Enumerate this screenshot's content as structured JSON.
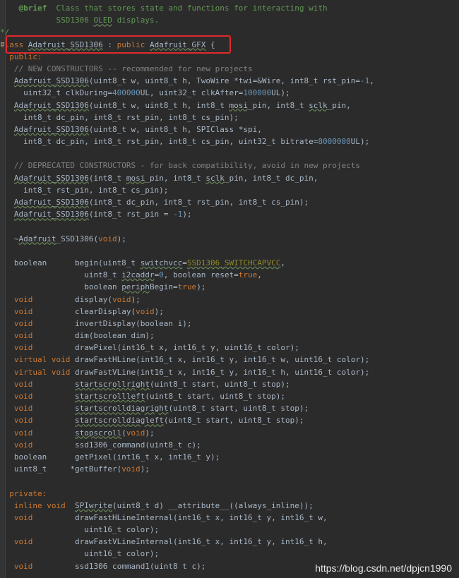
{
  "editor": {
    "lines": [
      [
        {
          "t": "    ",
          "c": "plain"
        },
        {
          "t": "@brief",
          "c": "tag"
        },
        {
          "t": "  Class that stores state and functions for interacting with",
          "c": "doc"
        }
      ],
      [
        {
          "t": "            SSD1306 ",
          "c": "doc"
        },
        {
          "t": "OLED",
          "c": "doc-ul"
        },
        {
          "t": " displays.",
          "c": "doc"
        }
      ],
      [
        {
          "t": "*/",
          "c": "doc"
        }
      ],
      [
        {
          "t": "class ",
          "c": "kw"
        },
        {
          "t": "Adafruit_SSD1306",
          "c": "ty-ul"
        },
        {
          "t": " : ",
          "c": "plain"
        },
        {
          "t": "public ",
          "c": "kw"
        },
        {
          "t": "Adafruit_GFX",
          "c": "ty-ul"
        },
        {
          "t": " {",
          "c": "plain"
        }
      ],
      [
        {
          "t": "  ",
          "c": "plain"
        },
        {
          "t": "public:",
          "c": "kw"
        }
      ],
      [
        {
          "t": "   ",
          "c": "plain"
        },
        {
          "t": "// NEW CONSTRUCTORS -- recommended for new projects",
          "c": "cmt"
        }
      ],
      [
        {
          "t": "   ",
          "c": "plain"
        },
        {
          "t": "Adafruit_SSD1306",
          "c": "fn-ul"
        },
        {
          "t": "(uint8_t w, uint8_t h, TwoWire *twi=&Wire, int8_t rst_pin=",
          "c": "plain"
        },
        {
          "t": "-1",
          "c": "num"
        },
        {
          "t": ",",
          "c": "plain"
        }
      ],
      [
        {
          "t": "     uint32_t clkDuring=",
          "c": "plain"
        },
        {
          "t": "400000",
          "c": "num"
        },
        {
          "t": "UL, uint32_t clkAfter=",
          "c": "plain"
        },
        {
          "t": "100000",
          "c": "num"
        },
        {
          "t": "UL);",
          "c": "plain"
        }
      ],
      [
        {
          "t": "   ",
          "c": "plain"
        },
        {
          "t": "Adafruit_SSD1306",
          "c": "fn-ul"
        },
        {
          "t": "(uint8_t w, uint8_t h, int8_t ",
          "c": "plain"
        },
        {
          "t": "mosi",
          "c": "plain-ul"
        },
        {
          "t": "_pin, int8_t ",
          "c": "plain"
        },
        {
          "t": "sclk",
          "c": "plain-ul"
        },
        {
          "t": "_pin,",
          "c": "plain"
        }
      ],
      [
        {
          "t": "     int8_t dc_pin, int8_t rst_pin, int8_t cs_pin);",
          "c": "plain"
        }
      ],
      [
        {
          "t": "   ",
          "c": "plain"
        },
        {
          "t": "Adafruit_SSD1306",
          "c": "fn-ul"
        },
        {
          "t": "(uint8_t w, uint8_t h, SPIClass *spi,",
          "c": "plain"
        }
      ],
      [
        {
          "t": "     int8_t dc_pin, int8_t rst_pin, int8_t cs_pin, uint32_t bitrate=",
          "c": "plain"
        },
        {
          "t": "8000000",
          "c": "num"
        },
        {
          "t": "UL);",
          "c": "plain"
        }
      ],
      [
        {
          "t": "",
          "c": "plain"
        }
      ],
      [
        {
          "t": "   ",
          "c": "plain"
        },
        {
          "t": "// DEPRECATED CONSTRUCTORS - for back compatibility, avoid in new projects",
          "c": "cmt"
        }
      ],
      [
        {
          "t": "   ",
          "c": "plain"
        },
        {
          "t": "Adafruit_SSD1306",
          "c": "fn-ul"
        },
        {
          "t": "(int8_t ",
          "c": "plain"
        },
        {
          "t": "mosi",
          "c": "plain-ul"
        },
        {
          "t": "_pin, int8_t ",
          "c": "plain"
        },
        {
          "t": "sclk",
          "c": "plain-ul"
        },
        {
          "t": "_pin, int8_t dc_pin,",
          "c": "plain"
        }
      ],
      [
        {
          "t": "     int8_t rst_pin, int8_t cs_pin);",
          "c": "plain"
        }
      ],
      [
        {
          "t": "   ",
          "c": "plain"
        },
        {
          "t": "Adafruit_SSD1306",
          "c": "fn-ul"
        },
        {
          "t": "(int8_t dc_pin, int8_t rst_pin, int8_t cs_pin);",
          "c": "plain"
        }
      ],
      [
        {
          "t": "   ",
          "c": "plain"
        },
        {
          "t": "Adafruit_SSD1306",
          "c": "fn-ul"
        },
        {
          "t": "(int8_t rst_pin = ",
          "c": "plain"
        },
        {
          "t": "-1",
          "c": "num"
        },
        {
          "t": ");",
          "c": "plain"
        }
      ],
      [
        {
          "t": "",
          "c": "plain"
        }
      ],
      [
        {
          "t": "   ~",
          "c": "plain"
        },
        {
          "t": "Adafruit",
          "c": "fn-ul"
        },
        {
          "t": "_SSD1306(",
          "c": "plain"
        },
        {
          "t": "void",
          "c": "kw"
        },
        {
          "t": ");",
          "c": "plain"
        }
      ],
      [
        {
          "t": "",
          "c": "plain"
        }
      ],
      [
        {
          "t": "   boolean      begin(uint8_t ",
          "c": "plain"
        },
        {
          "t": "switchvcc",
          "c": "plain-ul"
        },
        {
          "t": "=",
          "c": "plain"
        },
        {
          "t": "SSD1306_SWITCHCAPVCC",
          "c": "mac-ul"
        },
        {
          "t": ",",
          "c": "plain"
        }
      ],
      [
        {
          "t": "                  uint8_t ",
          "c": "plain"
        },
        {
          "t": "i2caddr",
          "c": "plain-ul"
        },
        {
          "t": "=",
          "c": "plain"
        },
        {
          "t": "0",
          "c": "num"
        },
        {
          "t": ", boolean reset=",
          "c": "plain"
        },
        {
          "t": "true",
          "c": "kw"
        },
        {
          "t": ",",
          "c": "plain"
        }
      ],
      [
        {
          "t": "                  boolean ",
          "c": "plain"
        },
        {
          "t": "periph",
          "c": "plain-ul"
        },
        {
          "t": "Begin=",
          "c": "plain"
        },
        {
          "t": "true",
          "c": "kw"
        },
        {
          "t": ");",
          "c": "plain"
        }
      ],
      [
        {
          "t": "   ",
          "c": "plain"
        },
        {
          "t": "void",
          "c": "kw"
        },
        {
          "t": "         display(",
          "c": "plain"
        },
        {
          "t": "void",
          "c": "kw"
        },
        {
          "t": ");",
          "c": "plain"
        }
      ],
      [
        {
          "t": "   ",
          "c": "plain"
        },
        {
          "t": "void",
          "c": "kw"
        },
        {
          "t": "         clearDisplay(",
          "c": "plain"
        },
        {
          "t": "void",
          "c": "kw"
        },
        {
          "t": ");",
          "c": "plain"
        }
      ],
      [
        {
          "t": "   ",
          "c": "plain"
        },
        {
          "t": "void",
          "c": "kw"
        },
        {
          "t": "         invertDisplay(boolean i);",
          "c": "plain"
        }
      ],
      [
        {
          "t": "   ",
          "c": "plain"
        },
        {
          "t": "void",
          "c": "kw"
        },
        {
          "t": "         dim(boolean dim);",
          "c": "plain"
        }
      ],
      [
        {
          "t": "   ",
          "c": "plain"
        },
        {
          "t": "void",
          "c": "kw"
        },
        {
          "t": "         drawPixel(int16_t x, int16_t y, uint16_t color);",
          "c": "plain"
        }
      ],
      [
        {
          "t": "   ",
          "c": "plain"
        },
        {
          "t": "virtual void",
          "c": "kw"
        },
        {
          "t": " drawFastHLine(int16_t x, int16_t y, int16_t w, uint16_t color);",
          "c": "plain"
        }
      ],
      [
        {
          "t": "   ",
          "c": "plain"
        },
        {
          "t": "virtual void",
          "c": "kw"
        },
        {
          "t": " drawFastVLine(int16_t x, int16_t y, int16_t h, uint16_t color);",
          "c": "plain"
        }
      ],
      [
        {
          "t": "   ",
          "c": "plain"
        },
        {
          "t": "void",
          "c": "kw"
        },
        {
          "t": "         ",
          "c": "plain"
        },
        {
          "t": "startscrollright",
          "c": "plain-ul"
        },
        {
          "t": "(uint8_t start, uint8_t stop);",
          "c": "plain"
        }
      ],
      [
        {
          "t": "   ",
          "c": "plain"
        },
        {
          "t": "void",
          "c": "kw"
        },
        {
          "t": "         ",
          "c": "plain"
        },
        {
          "t": "startscrollleft",
          "c": "plain-ul"
        },
        {
          "t": "(uint8_t start, uint8_t stop);",
          "c": "plain"
        }
      ],
      [
        {
          "t": "   ",
          "c": "plain"
        },
        {
          "t": "void",
          "c": "kw"
        },
        {
          "t": "         ",
          "c": "plain"
        },
        {
          "t": "startscrolldiagright",
          "c": "plain-ul"
        },
        {
          "t": "(uint8_t start, uint8_t stop);",
          "c": "plain"
        }
      ],
      [
        {
          "t": "   ",
          "c": "plain"
        },
        {
          "t": "void",
          "c": "kw"
        },
        {
          "t": "         ",
          "c": "plain"
        },
        {
          "t": "startscrolldiagleft",
          "c": "plain-ul"
        },
        {
          "t": "(uint8_t start, uint8_t stop);",
          "c": "plain"
        }
      ],
      [
        {
          "t": "   ",
          "c": "plain"
        },
        {
          "t": "void",
          "c": "kw"
        },
        {
          "t": "         ",
          "c": "plain"
        },
        {
          "t": "stopscroll",
          "c": "plain-ul"
        },
        {
          "t": "(",
          "c": "plain"
        },
        {
          "t": "void",
          "c": "kw"
        },
        {
          "t": ");",
          "c": "plain"
        }
      ],
      [
        {
          "t": "   ",
          "c": "plain"
        },
        {
          "t": "void",
          "c": "kw"
        },
        {
          "t": "         ssd1306_command(uint8_t c);",
          "c": "plain"
        }
      ],
      [
        {
          "t": "   boolean      getPixel(int16_t x, int16_t y);",
          "c": "plain"
        }
      ],
      [
        {
          "t": "   uint8_t     *getBuffer(",
          "c": "plain"
        },
        {
          "t": "void",
          "c": "kw"
        },
        {
          "t": ");",
          "c": "plain"
        }
      ],
      [
        {
          "t": "",
          "c": "plain"
        }
      ],
      [
        {
          "t": "  ",
          "c": "plain"
        },
        {
          "t": "private:",
          "c": "kw"
        }
      ],
      [
        {
          "t": "   ",
          "c": "plain"
        },
        {
          "t": "inline void",
          "c": "kw"
        },
        {
          "t": "  ",
          "c": "plain"
        },
        {
          "t": "SPIwrite",
          "c": "plain-ul"
        },
        {
          "t": "(uint8_t d) __attribute__((always_inline));",
          "c": "plain"
        }
      ],
      [
        {
          "t": "   ",
          "c": "plain"
        },
        {
          "t": "void",
          "c": "kw"
        },
        {
          "t": "         drawFastHLineInternal(int16_t x, int16_t y, int16_t w,",
          "c": "plain"
        }
      ],
      [
        {
          "t": "                  uint16_t color);",
          "c": "plain"
        }
      ],
      [
        {
          "t": "   ",
          "c": "plain"
        },
        {
          "t": "void",
          "c": "kw"
        },
        {
          "t": "         drawFastVLineInternal(int16_t x, int16_t y, int16_t h,",
          "c": "plain"
        }
      ],
      [
        {
          "t": "                  uint16_t color);",
          "c": "plain"
        }
      ],
      [
        {
          "t": "   ",
          "c": "plain"
        },
        {
          "t": "void",
          "c": "kw"
        },
        {
          "t": "         ssd1306 command1(uint8 t c);",
          "c": "plain"
        }
      ]
    ]
  },
  "watermark": "https://blog.csdn.net/dpjcn1990",
  "colors": {
    "background": "#2b2b2b",
    "keyword": "#cc7832",
    "number": "#6897bb",
    "comment": "#808080",
    "doc": "#629755",
    "highlight_box": "#e02a2a"
  }
}
